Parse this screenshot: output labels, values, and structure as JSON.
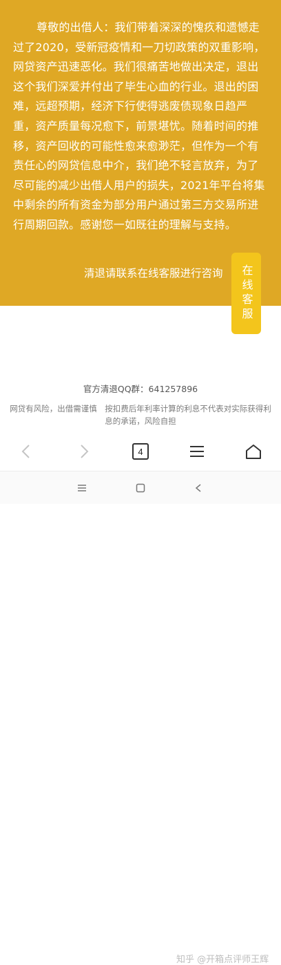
{
  "notice": {
    "body": "尊敬的出借人：我们带着深深的愧疚和遗憾走过了2020，受新冠疫情和一刀切政策的双重影响，网贷资产迅速恶化。我们很痛苦地做出决定，退出这个我们深爱并付出了毕生心血的行业。退出的困难，远超预期，经济下行使得逃废债现象日趋严重，资产质量每况愈下，前景堪忧。随着时间的推移，资产回收的可能性愈来愈渺茫，但作为一个有责任心的网贷信息中介，我们绝不轻言放弃，为了尽可能的减少出借人用户的损失，2021年平台将集中剩余的所有资金为部分用户通过第三方交易所进行周期回款。感谢您一如既往的理解与支持。",
    "contact": "清退请联系在线客服进行咨询",
    "bg_color": "#dfa825"
  },
  "service_button": {
    "label": "在线客服",
    "color": "#f3c51c"
  },
  "footer": {
    "qq": "官方清退QQ群：641257896",
    "risk": "网贷有风险，出借需谨慎　按扣费后年利率计算的利息不代表对实际获得利息的承诺，风险自担"
  },
  "toolbar": {
    "tab_count": "4",
    "icons": [
      "back-icon",
      "forward-icon",
      "tabs-icon",
      "menu-icon",
      "home-icon"
    ]
  },
  "navbar": {
    "icons": [
      "recent-apps-icon",
      "home-square-icon",
      "back-triangle-icon"
    ]
  },
  "watermark": "知乎 @开箱点评师王辉"
}
